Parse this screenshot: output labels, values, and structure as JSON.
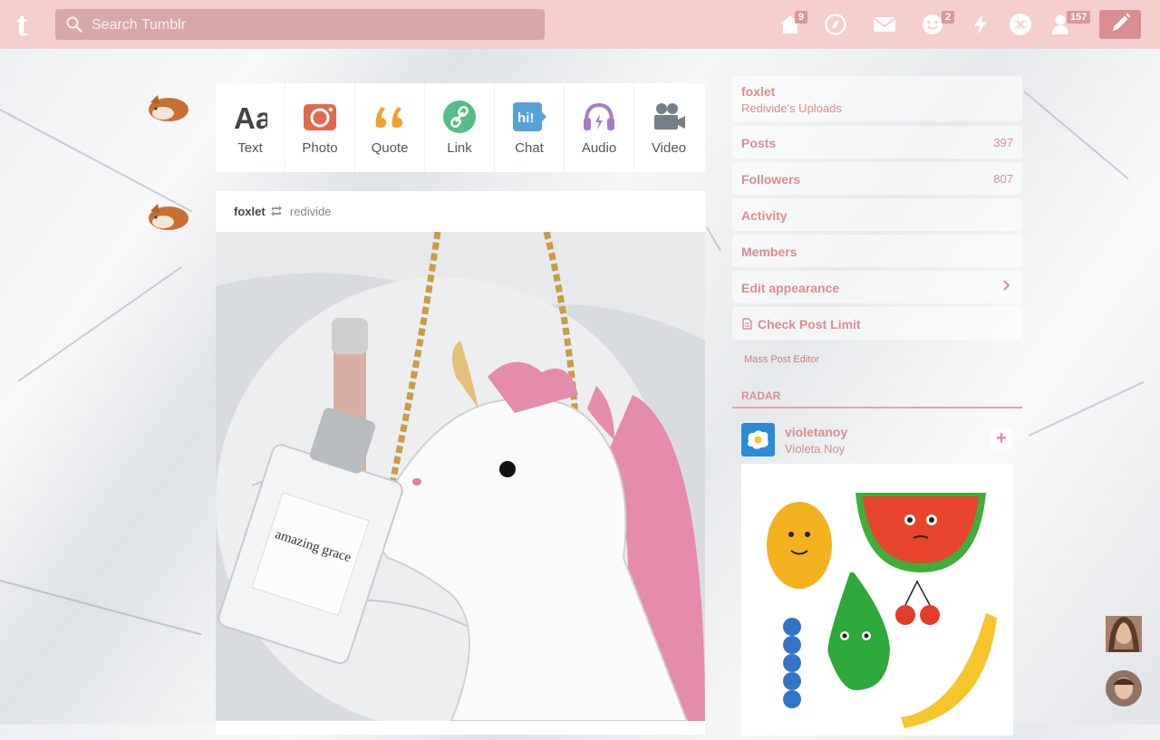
{
  "search": {
    "placeholder": "Search Tumblr"
  },
  "nav": {
    "dashboard_badge": "9",
    "activity_badge": "2",
    "account_badge": "157"
  },
  "composer": {
    "types": [
      {
        "label": "Text",
        "icon": "text-icon",
        "color": "#444444"
      },
      {
        "label": "Photo",
        "icon": "camera-icon",
        "color": "#e06a4f"
      },
      {
        "label": "Quote",
        "icon": "quote-icon",
        "color": "#f0a033"
      },
      {
        "label": "Link",
        "icon": "link-icon",
        "color": "#56bc8a"
      },
      {
        "label": "Chat",
        "icon": "chat-icon",
        "color": "#55a2d6"
      },
      {
        "label": "Audio",
        "icon": "headphones-icon",
        "color": "#a77dc2"
      },
      {
        "label": "Video",
        "icon": "video-camera-icon",
        "color": "#748089"
      }
    ]
  },
  "post": {
    "username": "foxlet",
    "reblogged_from": "redivide",
    "bottle_text": "amazing grace"
  },
  "sidebar": {
    "blog_name": "foxlet",
    "blog_title": "Redivide's Uploads",
    "items": [
      {
        "label": "Posts",
        "count": "397"
      },
      {
        "label": "Followers",
        "count": "807"
      },
      {
        "label": "Activity",
        "count": ""
      },
      {
        "label": "Members",
        "count": ""
      },
      {
        "label": "Edit appearance",
        "count": ""
      },
      {
        "label": "Check Post Limit",
        "count": ""
      }
    ],
    "mass_post_editor": "Mass Post Editor"
  },
  "radar": {
    "heading": "RADAR",
    "username": "violetanoy",
    "display_name": "Violeta Noy",
    "follow": "+"
  },
  "colors": {
    "topbar": "#f5cece",
    "accent": "#d98e92",
    "search_bg": "#d6a8a8"
  }
}
